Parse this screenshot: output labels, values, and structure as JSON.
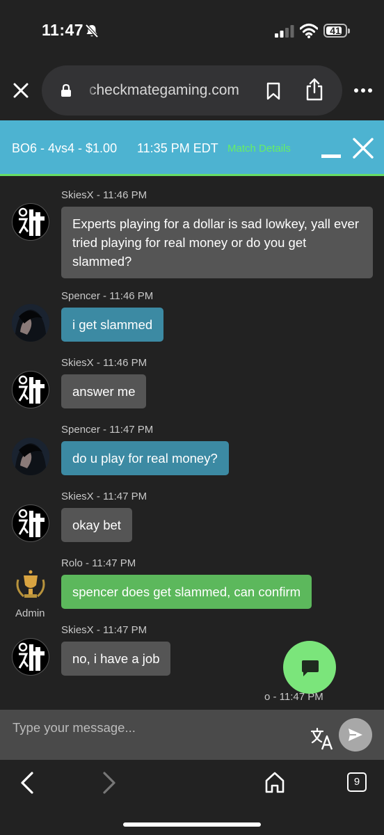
{
  "status_bar": {
    "time": "11:47",
    "battery": "41"
  },
  "browser": {
    "url": "checkmategaming.com"
  },
  "match": {
    "title": "BO6 - 4vs4 - $1.00",
    "time": "11:35 PM EDT",
    "details_link": "Match Details"
  },
  "messages": [
    {
      "sender": "SkiesX - 11:46 PM",
      "text": "Experts playing for a dollar is sad lowkey, yall ever tried playing for real money or do you get slammed?"
    },
    {
      "sender": "Spencer - 11:46 PM",
      "text": "i get slammed"
    },
    {
      "sender": "SkiesX - 11:46 PM",
      "text": "answer me"
    },
    {
      "sender": "Spencer - 11:47 PM",
      "text": "do u play for real money?"
    },
    {
      "sender": "SkiesX - 11:47 PM",
      "text": "okay bet"
    },
    {
      "sender": "Rolo - 11:47 PM",
      "text": "spencer does get slammed, can confirm",
      "badge": "Admin"
    },
    {
      "sender": "SkiesX - 11:47 PM",
      "text": "no, i have a job"
    },
    {
      "sender": "o - 11:47 PM"
    }
  ],
  "composer": {
    "placeholder": "Type your message..."
  },
  "nav": {
    "tab_count": "9"
  },
  "colors": {
    "header": "#4db3d1",
    "bubble_other": "#555555",
    "bubble_self": "#3c8aa3",
    "bubble_admin": "#5cb85c",
    "fab": "#7be57b"
  }
}
